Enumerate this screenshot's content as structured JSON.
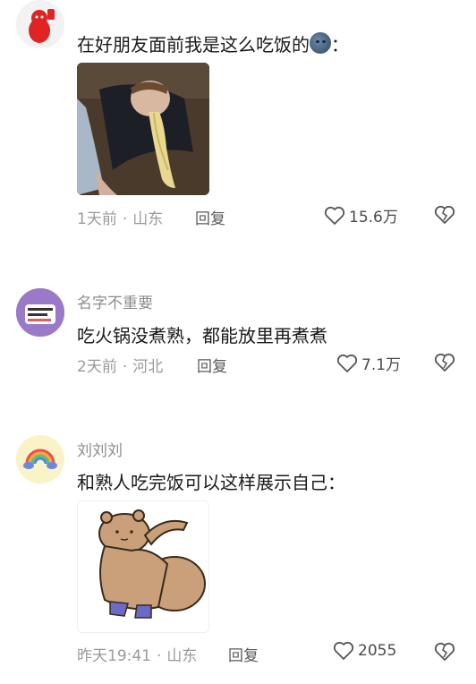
{
  "comments": [
    {
      "username": "",
      "text": "在好朋友面前我是这么吃饭的",
      "text_suffix": "：",
      "emoji": "dark-moon-face-emoji",
      "image": "man-eating-noodles-meme",
      "time": "1天前",
      "location": "山东",
      "reply_label": "回复",
      "likes": "15.6万"
    },
    {
      "username": "名字不重要",
      "text": "吃火锅没煮熟，都能放里再煮煮",
      "time": "2天前",
      "location": "河北",
      "reply_label": "回复",
      "likes": "7.1万"
    },
    {
      "username": "刘刘刘",
      "text": "和熟人吃完饭可以这样展示自己：",
      "image": "chubby-bear-sticker",
      "time": "昨天19:41",
      "location": "山东",
      "reply_label": "回复",
      "likes": "2055"
    }
  ],
  "meta_separator": "·"
}
